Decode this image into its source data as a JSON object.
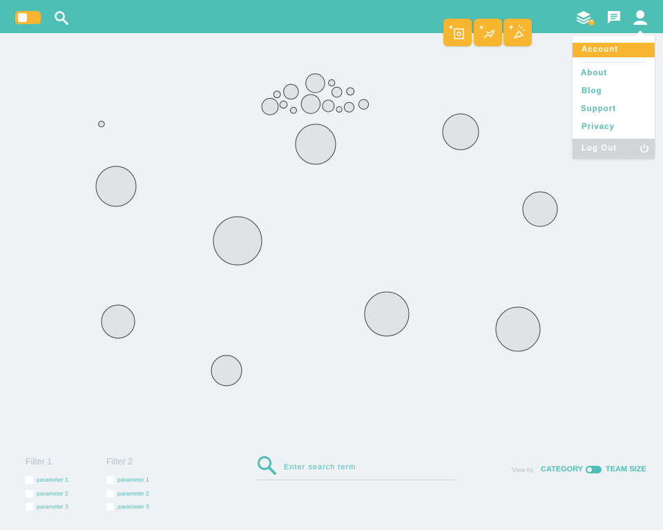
{
  "colors": {
    "teal": "#4dbfb5",
    "amber": "#f7b530",
    "bubble_fill": "#e0e2e4",
    "bubble_stroke": "#3f3f3f"
  },
  "header": {
    "toggle_icon": "toggle-switch",
    "search_icon": "search-icon",
    "actions": [
      {
        "name": "add-puzzle-action",
        "icon": "puzzle-sparkle-icon"
      },
      {
        "name": "add-team-action",
        "icon": "handshake-sparkle-icon"
      },
      {
        "name": "add-announcement-action",
        "icon": "megaphone-sparkle-icon"
      }
    ],
    "layers_badge": "4",
    "icons": [
      "layers-icon",
      "chat-icon",
      "user-icon"
    ]
  },
  "user_menu": {
    "items": [
      "Account",
      "About",
      "Blog",
      "Support",
      "Privacy"
    ],
    "active": "Account",
    "logout": "Log Out"
  },
  "filters": [
    {
      "title": "Filter 1",
      "options": [
        "parameter 1",
        "parameter 2",
        "parameter 3"
      ]
    },
    {
      "title": "Filter 2",
      "options": [
        "parameter 1",
        "parameter 2",
        "parameter 3"
      ]
    }
  ],
  "search": {
    "placeholder": "Enter search term"
  },
  "view_by": {
    "label": "View by",
    "option_a": "CATEGORY",
    "option_b": "TEAM SIZE"
  }
}
